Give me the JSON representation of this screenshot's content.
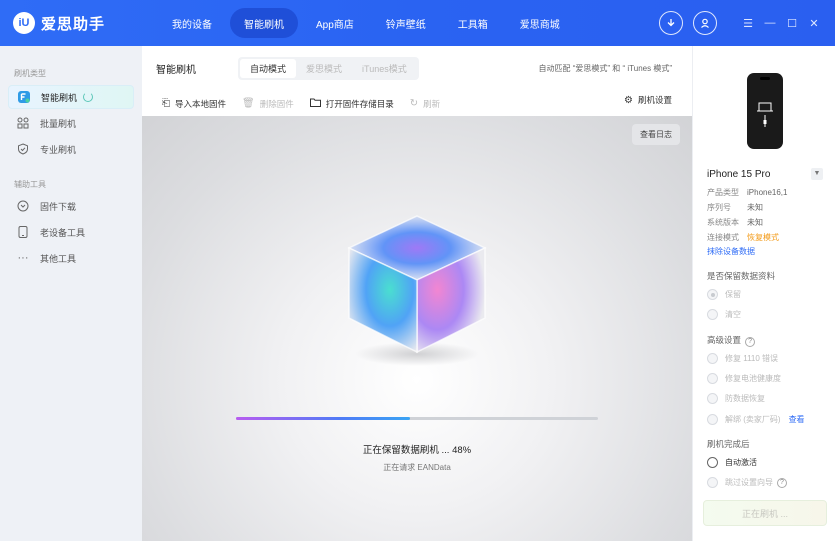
{
  "app": {
    "logo_mark": "iU",
    "name": "爱思助手"
  },
  "nav": [
    {
      "label": "我的设备",
      "active": false
    },
    {
      "label": "智能刷机",
      "active": true
    },
    {
      "label": "App商店",
      "active": false
    },
    {
      "label": "铃声壁纸",
      "active": false
    },
    {
      "label": "工具箱",
      "active": false
    },
    {
      "label": "爱思商城",
      "active": false
    }
  ],
  "topbar_icons": [
    "download-icon",
    "user-icon"
  ],
  "window_buttons": [
    "menu-icon",
    "minimize-icon",
    "maximize-icon",
    "close-icon"
  ],
  "sidebar": {
    "group1": "刷机类型",
    "group1_items": [
      {
        "label": "智能刷机",
        "icon": "smart-flash-icon",
        "active": true
      },
      {
        "label": "批量刷机",
        "icon": "batch-flash-icon",
        "active": false
      },
      {
        "label": "专业刷机",
        "icon": "shield-check-icon",
        "active": false
      }
    ],
    "group2": "辅助工具",
    "group2_items": [
      {
        "label": "固件下载",
        "icon": "download-circle-icon"
      },
      {
        "label": "老设备工具",
        "icon": "old-device-icon"
      },
      {
        "label": "其他工具",
        "icon": "more-dots-icon"
      }
    ]
  },
  "main": {
    "title": "智能刷机",
    "mode_tabs": [
      {
        "label": "自动模式",
        "active": true
      },
      {
        "label": "爱思模式",
        "active": false
      },
      {
        "label": "iTunes模式",
        "active": false
      }
    ],
    "auto_match": "自动匹配 “爱思模式” 和 “ iTunes 模式”",
    "toolbar": {
      "import": "导入本地固件",
      "delete": "删除固件",
      "open_dir": "打开固件存储目录",
      "refresh": "刷新",
      "settings": "刷机设置"
    },
    "view_log": "查看日志",
    "progress_percent": 48,
    "status": "正在保留数据刷机 ... 48%",
    "substatus": "正在请求 EANData"
  },
  "device": {
    "name": "iPhone 15 Pro",
    "rows": [
      {
        "label": "产品类型",
        "value": "iPhone16,1",
        "warn": false
      },
      {
        "label": "序列号",
        "value": "未知",
        "warn": false
      },
      {
        "label": "系统版本",
        "value": "未知",
        "warn": false
      },
      {
        "label": "连接模式",
        "value": "恢复模式",
        "warn": true
      }
    ],
    "erase_link": "抹除设备数据"
  },
  "options": {
    "keep_title": "是否保留数据资料",
    "keep": "保留",
    "clear": "清空",
    "advanced_title": "高级设置",
    "repair_1110": "修复 1110 错误",
    "repair_battery": "修复电池健康度",
    "anti_data_recovery": "防数据恢复",
    "unlock": "解绑 (卖家厂码)",
    "view_link": "查看",
    "after_title": "刷机完成后",
    "auto_activate": "自动激活",
    "skip_wizard": "跳过设置向导"
  },
  "flash_button": "正在刷机 ..."
}
